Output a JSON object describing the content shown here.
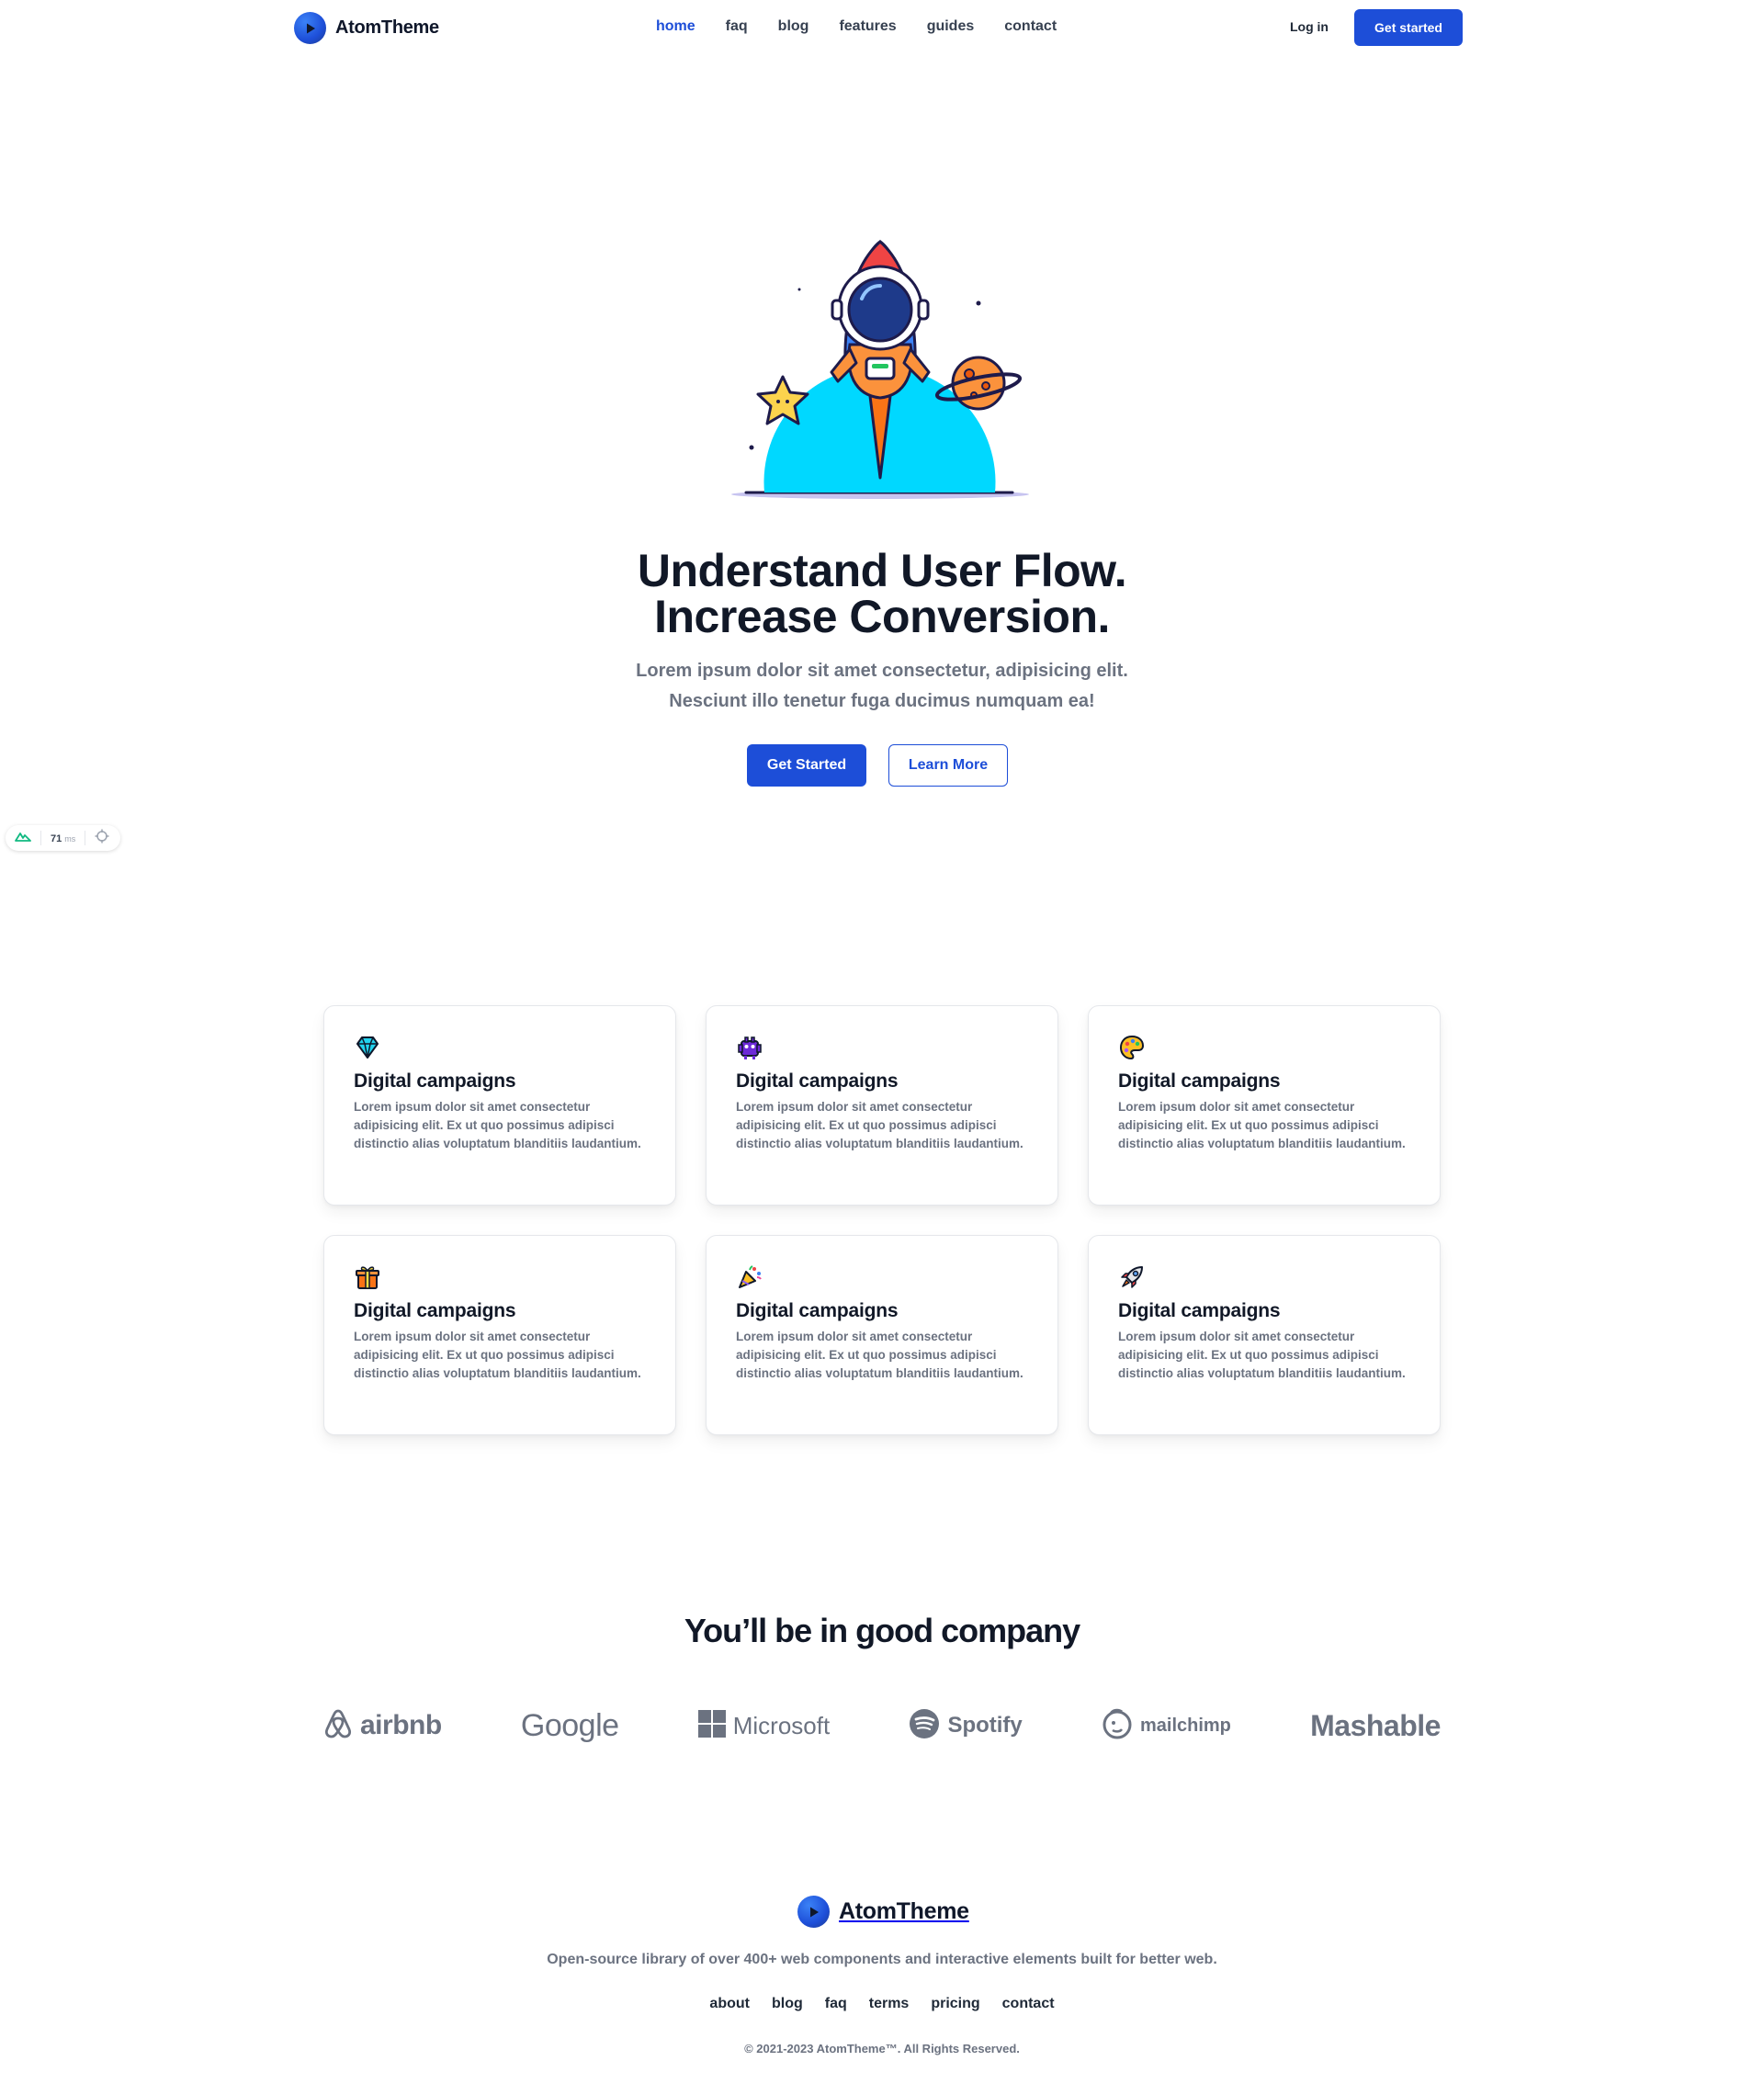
{
  "header": {
    "brand": "AtomTheme",
    "nav": [
      {
        "label": "home",
        "active": true
      },
      {
        "label": "faq",
        "active": false
      },
      {
        "label": "blog",
        "active": false
      },
      {
        "label": "features",
        "active": false
      },
      {
        "label": "guides",
        "active": false
      },
      {
        "label": "contact",
        "active": false
      }
    ],
    "login_label": "Log in",
    "cta_label": "Get started"
  },
  "hero": {
    "illustration": "astronaut-rocket-illustration",
    "title_line1": "Understand User Flow.",
    "title_line2": "Increase Conversion.",
    "subtitle_line1": "Lorem ipsum dolor sit amet consectetur, adipisicing elit.",
    "subtitle_line2": "Nesciunt illo tenetur fuga ducimus numquam ea!",
    "primary_button": "Get Started",
    "secondary_button": "Learn More"
  },
  "perf_widget": {
    "value": "71",
    "unit": "ms"
  },
  "features": {
    "cards": [
      {
        "icon": "diamond-icon",
        "title": "Digital campaigns",
        "body": "Lorem ipsum dolor sit amet consectetur adipisicing elit. Ex ut quo possimus adipisci distinctio alias voluptatum blanditiis laudantium."
      },
      {
        "icon": "alien-monster-icon",
        "title": "Digital campaigns",
        "body": "Lorem ipsum dolor sit amet consectetur adipisicing elit. Ex ut quo possimus adipisci distinctio alias voluptatum blanditiis laudantium."
      },
      {
        "icon": "palette-icon",
        "title": "Digital campaigns",
        "body": "Lorem ipsum dolor sit amet consectetur adipisicing elit. Ex ut quo possimus adipisci distinctio alias voluptatum blanditiis laudantium."
      },
      {
        "icon": "gift-icon",
        "title": "Digital campaigns",
        "body": "Lorem ipsum dolor sit amet consectetur adipisicing elit. Ex ut quo possimus adipisci distinctio alias voluptatum blanditiis laudantium."
      },
      {
        "icon": "party-popper-icon",
        "title": "Digital campaigns",
        "body": "Lorem ipsum dolor sit amet consectetur adipisicing elit. Ex ut quo possimus adipisci distinctio alias voluptatum blanditiis laudantium."
      },
      {
        "icon": "rocket-icon",
        "title": "Digital campaigns",
        "body": "Lorem ipsum dolor sit amet consectetur adipisicing elit. Ex ut quo possimus adipisci distinctio alias voluptatum blanditiis laudantium."
      }
    ]
  },
  "company": {
    "title": "You’ll be in good company",
    "logos": [
      "airbnb",
      "Google",
      "Microsoft",
      "Spotify",
      "mailchimp",
      "Mashable"
    ]
  },
  "footer": {
    "brand": "AtomTheme",
    "description": "Open-source library of over 400+ web components and interactive elements built for better web.",
    "nav": [
      "about",
      "blog",
      "faq",
      "terms",
      "pricing",
      "contact"
    ],
    "copyright": "© 2021-2023 AtomTheme™. All Rights Reserved."
  },
  "colors": {
    "primary": "#1d4ed8",
    "text_dark": "#111827",
    "text_muted": "#6b7280",
    "illustration_cyan": "#00d8ff"
  }
}
